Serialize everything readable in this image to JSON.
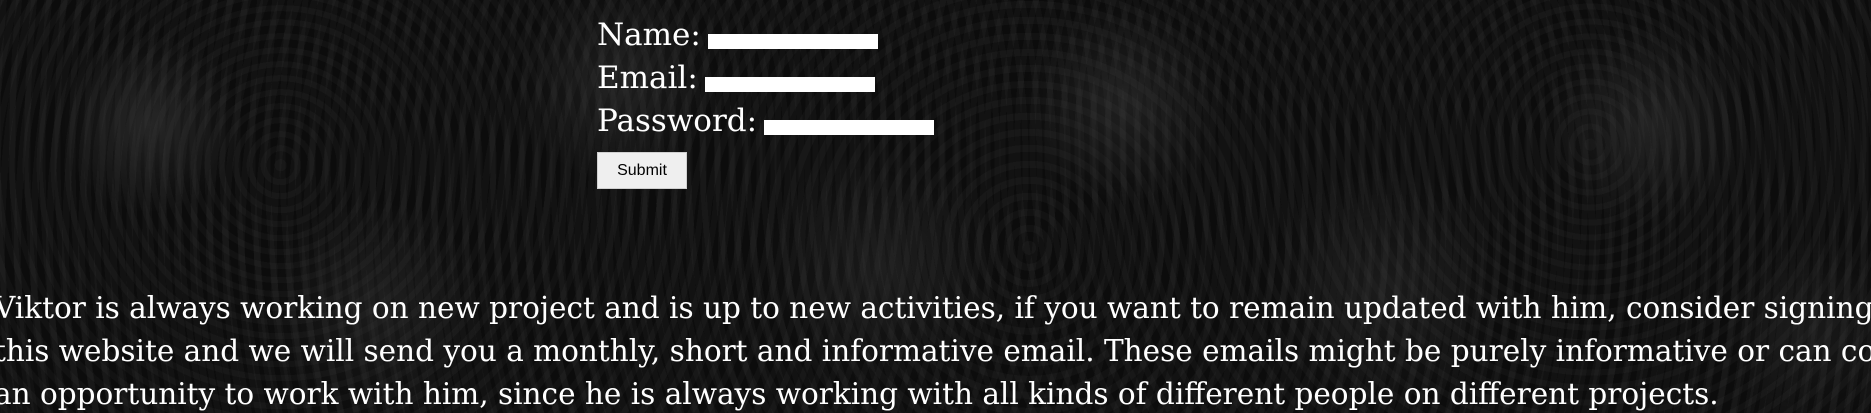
{
  "form": {
    "name_label": "Name:",
    "email_label": "Email:",
    "password_label": "Password:",
    "name_value": "",
    "email_value": "",
    "password_value": "",
    "submit_label": "Submit"
  },
  "blurb": {
    "line1": "Viktor is always working on new project and is up to new activities, if you want to remain updated with him, consider signing up to",
    "line2": "this website and we will send you a monthly, short and informative email. These emails might be purely informative or can contain",
    "line3": "an opportunity to work with him, since he is always working with all kinds of different people on different projects."
  },
  "colors": {
    "background": "#0c0c0c",
    "text": "#ffffff",
    "field": "#ffffff",
    "button": "#efefef"
  }
}
